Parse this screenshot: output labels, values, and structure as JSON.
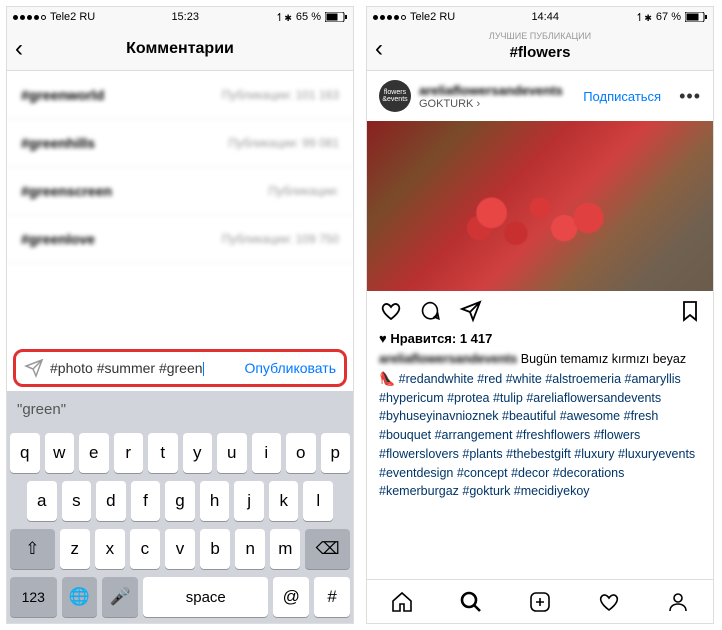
{
  "left": {
    "status": {
      "carrier": "Tele2 RU",
      "time": "15:23",
      "battery": "65 %"
    },
    "nav_title": "Комментарии",
    "suggestions": [
      {
        "tag": "#greenworld",
        "meta": "Публикации: 101 163"
      },
      {
        "tag": "#greenhills",
        "meta": "Публикации: 99 081"
      },
      {
        "tag": "#greenscreen",
        "meta": "Публикации:"
      },
      {
        "tag": "#greenlove",
        "meta": "Публикации: 109 750"
      }
    ],
    "compose_text": "#photo #summer #green",
    "publish_label": "Опубликовать",
    "kb_suggest": "\"green\"",
    "kb_rows": {
      "r1": [
        "q",
        "w",
        "e",
        "r",
        "t",
        "y",
        "u",
        "i",
        "o",
        "p"
      ],
      "r2": [
        "a",
        "s",
        "d",
        "f",
        "g",
        "h",
        "j",
        "k",
        "l"
      ],
      "r3_shift": "⇧",
      "r3_keys": [
        "z",
        "x",
        "c",
        "v",
        "b",
        "n",
        "m"
      ],
      "r3_del": "⌫",
      "r4": {
        "num": "123",
        "globe": "🌐",
        "mic": "🎤",
        "space": "space",
        "at": "@",
        "hash": "#"
      }
    }
  },
  "right": {
    "status": {
      "carrier": "Tele2 RU",
      "time": "14:44",
      "battery": "67 %"
    },
    "nav_subtitle": "ЛУЧШИЕ ПУБЛИКАЦИИ",
    "nav_title": "#flowers",
    "post": {
      "avatar_text": "flowers &events",
      "username": "areliaflowersandevents",
      "location": "GOKTURK ›",
      "follow": "Подписаться",
      "likes_label": "Нравится: 1 417",
      "caption_user": "areliaflowersandevents",
      "caption_lead": "Bugün temamız kırmızı beyaz",
      "tags": [
        "#redandwhite",
        "#red",
        "#white",
        "#alstroemeria",
        "#amaryllis",
        "#hypericum",
        "#protea",
        "#tulip",
        "#areliaflowersandevents",
        "#byhuseyinavnioznek",
        "#beautiful",
        "#awesome",
        "#fresh",
        "#bouquet",
        "#arrangement",
        "#freshflowers",
        "#flowers",
        "#flowerslovers",
        "#plants",
        "#thebestgift",
        "#luxury",
        "#luxuryevents",
        "#eventdesign",
        "#concept",
        "#decor",
        "#decorations",
        "#kemerburgaz",
        "#gokturk",
        "#mecidiyekoy"
      ]
    }
  }
}
